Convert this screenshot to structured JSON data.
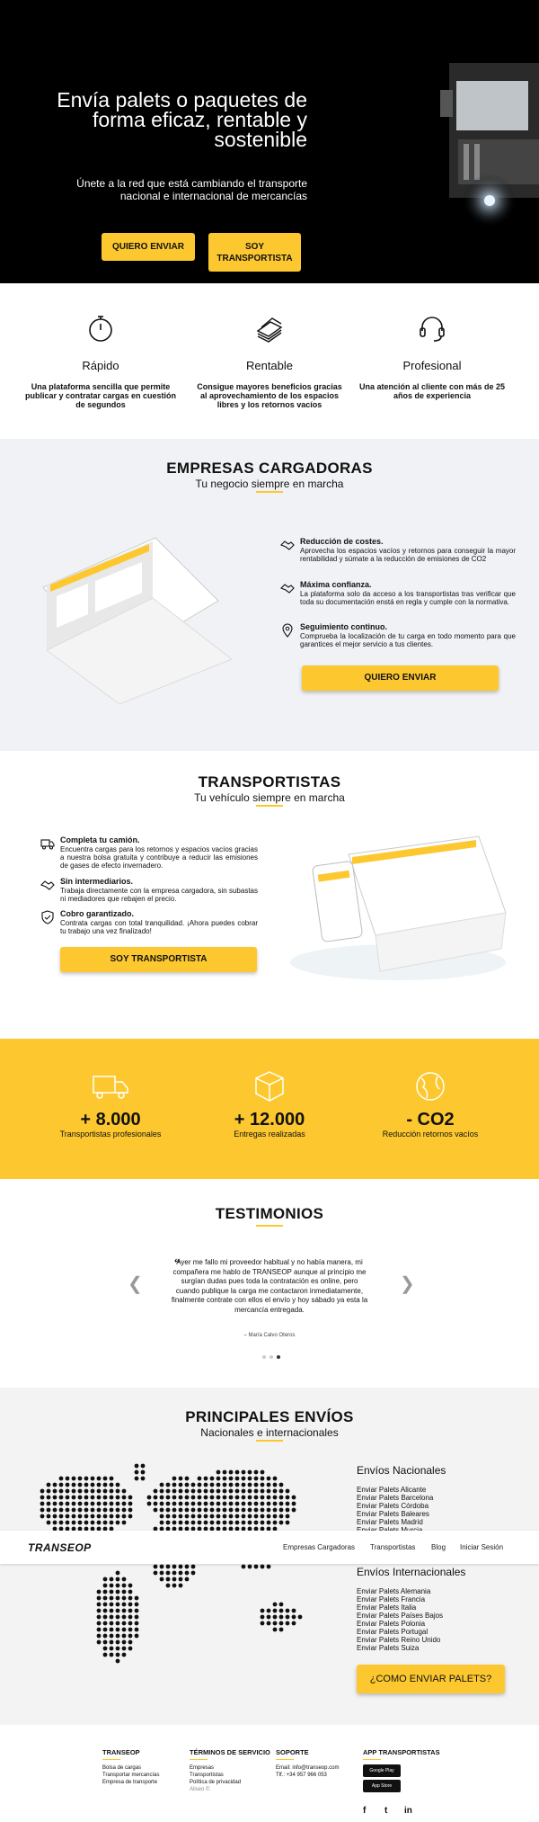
{
  "hero": {
    "title": "Envía palets o paquetes de forma eficaz, rentable y sostenible",
    "subtitle": "Únete a la red que está cambiando el transporte nacional e internacional de mercancías",
    "btn_send": "QUIERO ENVIAR",
    "btn_carrier": "SOY TRANSPORTISTA"
  },
  "features": [
    {
      "title": "Rápido",
      "text": "Una plataforma sencilla que permite publicar y contratar cargas en cuestión de segundos",
      "icon": "stopwatch-icon"
    },
    {
      "title": "Rentable",
      "text": "Consigue mayores beneficios gracias al aprovechamiento de los espacios libres y los retornos vacíos",
      "icon": "money-icon"
    },
    {
      "title": "Profesional",
      "text": "Una atención al cliente con más de 25 años de experiencia",
      "icon": "headset-icon"
    }
  ],
  "empresas": {
    "title": "EMPRESAS CARGADORAS",
    "subtitle": "Tu negocio siempre en marcha",
    "items": [
      {
        "title": "Reducción de costes.",
        "text": "Aprovecha los espacios vacíos y retornos para conseguir la mayor rentabilidad y súmate a la reducción de emisiones de CO2"
      },
      {
        "title": "Máxima confianza.",
        "text": "La plataforma solo da acceso a los transportistas tras verificar que toda su documentación enstá en regla y cumple con la normativa."
      },
      {
        "title": "Seguimiento continuo.",
        "text": "Comprueba la localización de tu carga en todo momento para que garantices el mejor servicio a tus clientes."
      }
    ],
    "cta": "QUIERO ENVIAR"
  },
  "transportistas": {
    "title": "TRANSPORTISTAS",
    "subtitle": "Tu vehículo siempre en marcha",
    "items": [
      {
        "title": "Completa tu camión.",
        "text": "Encuentra cargas para los retornos y espacios vacíos gracias a nuestra bolsa gratuita y contribuye a reducir las emisiones de gases de efecto invernadero."
      },
      {
        "title": "Sin intermediarios.",
        "text": "Trabaja directamente con la empresa cargadora, sin subastas ni mediadores que rebajen el precio."
      },
      {
        "title": "Cobro garantizado.",
        "text": "Contrata cargas con total tranquilidad. ¡Ahora puedes cobrar tu trabajo una vez finalizado!"
      }
    ],
    "cta": "SOY TRANSPORTISTA"
  },
  "stats": [
    {
      "num": "+ 8.000",
      "label": "Transportistas profesionales"
    },
    {
      "num": "+ 12.000",
      "label": "Entregas realizadas"
    },
    {
      "num": "- CO2",
      "label": "Reducción retornos vacíos"
    }
  ],
  "testimonios": {
    "title": "TESTIMONIOS",
    "quote": "Ayer me fallo mi proveedor habitual y no había manera, mi compañera me hablo de TRANSEOP aunque al principio me surgían dudas pues toda la contratación es online, pero cuando publique la carga me contactaron inmediatamente, finalmente contrate con ellos el envío y hoy sábado ya esta la mercancía entregada.",
    "author": "– María Calvo Oteros"
  },
  "envios": {
    "title": "PRINCIPALES ENVÍOS",
    "subtitle": "Nacionales e internacionales",
    "nacionales_title": "Envíos Nacionales",
    "nacionales": [
      "Enviar Palets Alicante",
      "Enviar Palets Barcelona",
      "Enviar Palets Córdoba",
      "Enviar Palets Baleares",
      "Enviar Palets Madrid",
      "Enviar Palets Murcia"
    ],
    "internacionales_title": "Envíos Internacionales",
    "internacionales": [
      "Enviar Palets Alemania",
      "Enviar Palets Francia",
      "Enviar Palets Italia",
      "Enviar Palets Países Bajos",
      "Enviar Palets Polonia",
      "Enviar Palets Portugal",
      "Enviar Palets Reino Unido",
      "Enviar Palets Suiza"
    ],
    "cta": "¿COMO ENVIAR PALETS?"
  },
  "navbar": {
    "logo": "TRANSEOP",
    "links": [
      "Empresas Cargadoras",
      "Transportistas",
      "Blog",
      "Iniciar Sesión"
    ]
  },
  "footer": {
    "col1": {
      "title": "TRANSEOP",
      "links": [
        "Bolsa de cargas",
        "Transportar mercancías",
        "Empresa de transporte"
      ]
    },
    "col2": {
      "title": "TÉRMINOS DE SERVICIO",
      "links": [
        "Empresas",
        "Transportistas",
        "Política de privacidad",
        "Aliseo ©"
      ]
    },
    "col3": {
      "title": "SOPORTE",
      "links": [
        "Email: info@transeop.com",
        "Tlf.: +34 957 966 053"
      ]
    },
    "col4": {
      "title": "APP TRANSPORTISTAS",
      "stores": [
        "Google Play",
        "App Store"
      ]
    },
    "social": [
      "f",
      "t",
      "in"
    ]
  }
}
